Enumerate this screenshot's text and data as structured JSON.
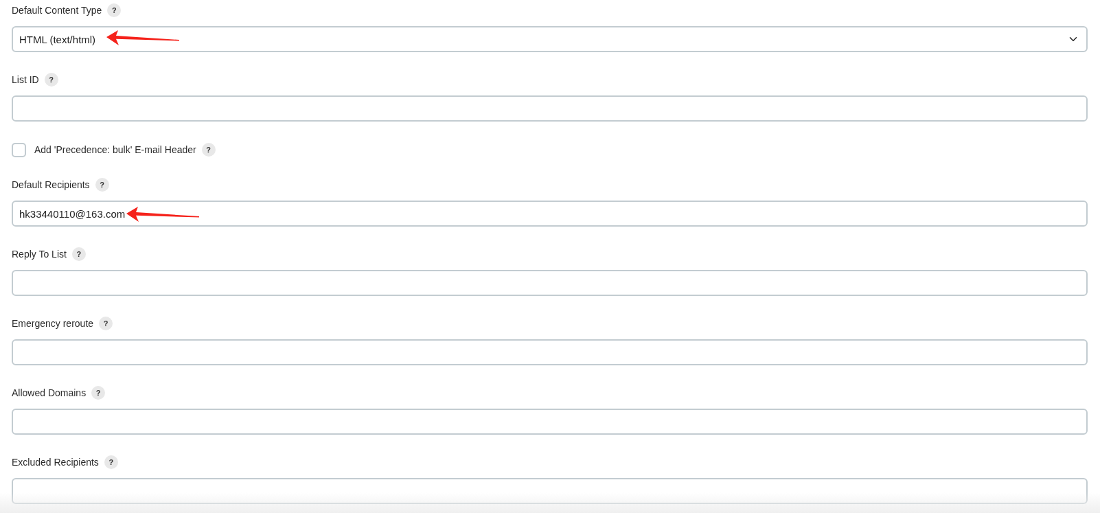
{
  "fields": [
    {
      "kind": "select",
      "label": "Default Content Type",
      "help": "?",
      "value": "HTML (text/html)",
      "arrow_marker": true
    },
    {
      "kind": "text",
      "label": "List ID",
      "help": "?",
      "arrow_marker": false
    },
    {
      "kind": "checkbox",
      "label": "Add 'Precedence: bulk' E-mail Header",
      "help": "?",
      "checked": false,
      "arrow_marker": false
    },
    {
      "kind": "text",
      "label": "Default Recipients",
      "help": "?",
      "value": "hk33440110@163.com",
      "arrow_marker": true
    },
    {
      "kind": "text",
      "label": "Reply To List",
      "help": "?",
      "arrow_marker": false
    },
    {
      "kind": "text",
      "label": "Emergency reroute",
      "help": "?",
      "arrow_marker": false
    },
    {
      "kind": "text",
      "label": "Allowed Domains",
      "help": "?",
      "arrow_marker": false
    },
    {
      "kind": "text",
      "label": "Excluded Recipients",
      "help": "?",
      "arrow_marker": false
    }
  ]
}
